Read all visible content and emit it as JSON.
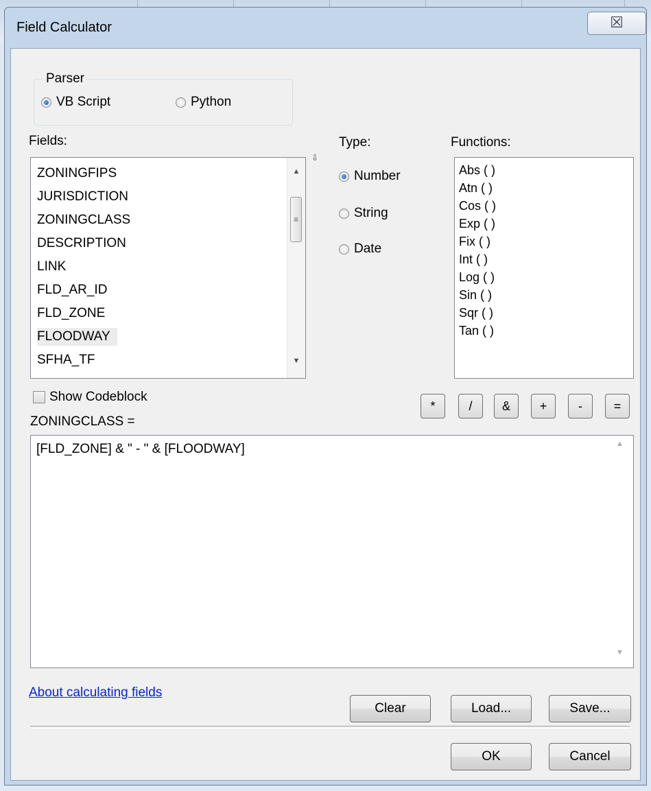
{
  "window": {
    "title": "Field Calculator",
    "close_glyph": "☒"
  },
  "parser": {
    "legend": "Parser",
    "options": [
      {
        "label": "VB Script",
        "selected": true
      },
      {
        "label": "Python",
        "selected": false
      }
    ]
  },
  "fields": {
    "label": "Fields:",
    "items": [
      "ZONINGFIPS",
      "JURISDICTION",
      "ZONINGCLASS",
      "DESCRIPTION",
      "LINK",
      "FLD_AR_ID",
      "FLD_ZONE",
      "FLOODWAY",
      "SFHA_TF"
    ],
    "highlighted": "FLOODWAY",
    "sort_glyph": "⇩"
  },
  "type": {
    "label": "Type:",
    "options": [
      {
        "label": "Number",
        "selected": true
      },
      {
        "label": "String",
        "selected": false
      },
      {
        "label": "Date",
        "selected": false
      }
    ]
  },
  "functions": {
    "label": "Functions:",
    "items": [
      "Abs ( )",
      "Atn ( )",
      "Cos ( )",
      "Exp ( )",
      "Fix ( )",
      "Int ( )",
      "Log ( )",
      "Sin ( )",
      "Sqr ( )",
      "Tan ( )"
    ]
  },
  "codeblock": {
    "label": "Show Codeblock",
    "checked": false
  },
  "operators": [
    "*",
    "/",
    "&",
    "+",
    "-",
    "="
  ],
  "expression": {
    "label": "ZONINGCLASS =",
    "value": "[FLD_ZONE] & \" - \" & [FLOODWAY]"
  },
  "help_link": "About calculating fields",
  "buttons": {
    "clear": "Clear",
    "load": "Load...",
    "save": "Save...",
    "ok": "OK",
    "cancel": "Cancel"
  }
}
